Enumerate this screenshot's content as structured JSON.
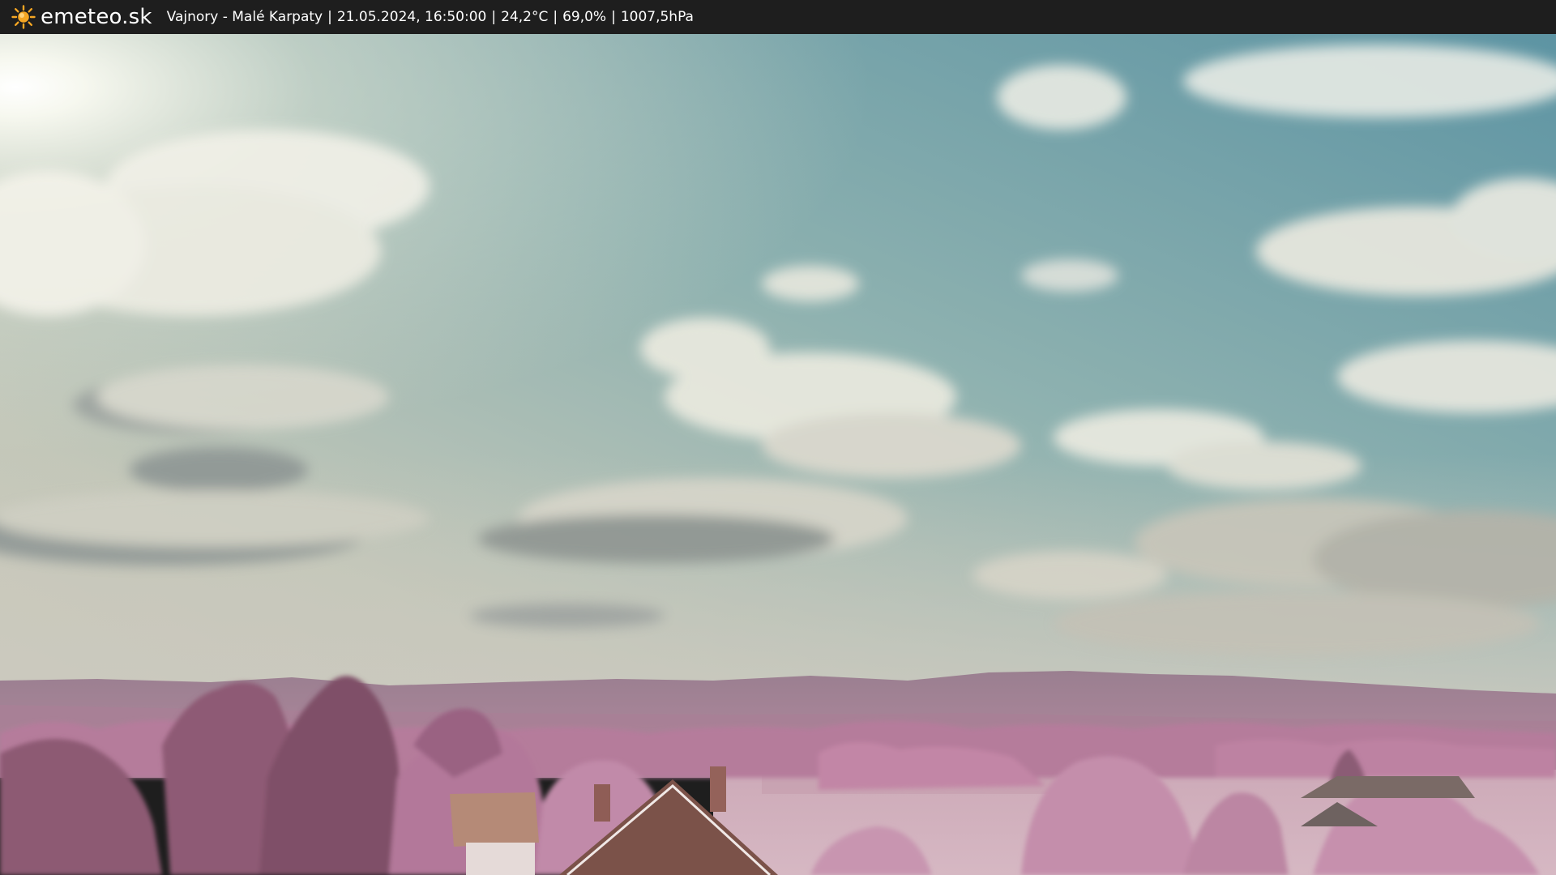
{
  "header": {
    "logo_icon": "sun-icon",
    "brand": "emeteo.sk",
    "location": "Vajnory - Malé Karpaty",
    "datetime": "21.05.2024, 16:50:00",
    "temperature": "24,2°C",
    "humidity": "69,0%",
    "pressure": "1007,5hPa",
    "separator": "|"
  },
  "colors": {
    "bar_background": "#1e1e1e",
    "bar_text": "#ffffff",
    "sun_icon": "#f5a623",
    "sky_top": "#6a9ca6",
    "sky_bottom": "#c9c9bb",
    "foliage": "#b07a97",
    "field": "#d0b0bc"
  }
}
